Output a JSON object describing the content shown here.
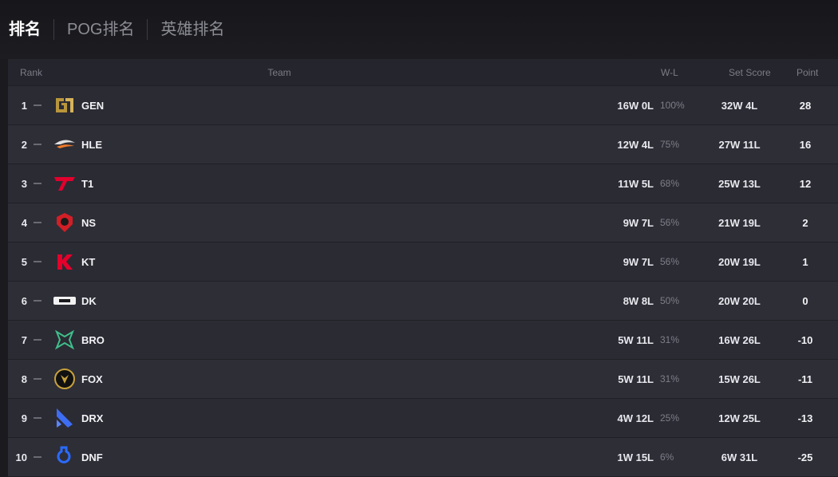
{
  "tabs": [
    {
      "label": "排名",
      "active": true
    },
    {
      "label": "POG排名",
      "active": false
    },
    {
      "label": "英雄排名",
      "active": false
    }
  ],
  "headers": {
    "rank": "Rank",
    "team": "Team",
    "wl": "W-L",
    "set": "Set Score",
    "point": "Point"
  },
  "rows": [
    {
      "rank": "1",
      "team": "GEN",
      "wl": "16W 0L",
      "pct": "100%",
      "set": "32W 4L",
      "point": "28",
      "logo": "gen-logo-icon"
    },
    {
      "rank": "2",
      "team": "HLE",
      "wl": "12W 4L",
      "pct": "75%",
      "set": "27W 11L",
      "point": "16",
      "logo": "hle-logo-icon"
    },
    {
      "rank": "3",
      "team": "T1",
      "wl": "11W 5L",
      "pct": "68%",
      "set": "25W 13L",
      "point": "12",
      "logo": "t1-logo-icon"
    },
    {
      "rank": "4",
      "team": "NS",
      "wl": "9W 7L",
      "pct": "56%",
      "set": "21W 19L",
      "point": "2",
      "logo": "ns-logo-icon"
    },
    {
      "rank": "5",
      "team": "KT",
      "wl": "9W 7L",
      "pct": "56%",
      "set": "20W 19L",
      "point": "1",
      "logo": "kt-logo-icon"
    },
    {
      "rank": "6",
      "team": "DK",
      "wl": "8W 8L",
      "pct": "50%",
      "set": "20W 20L",
      "point": "0",
      "logo": "dk-logo-icon"
    },
    {
      "rank": "7",
      "team": "BRO",
      "wl": "5W 11L",
      "pct": "31%",
      "set": "16W 26L",
      "point": "-10",
      "logo": "bro-logo-icon"
    },
    {
      "rank": "8",
      "team": "FOX",
      "wl": "5W 11L",
      "pct": "31%",
      "set": "15W 26L",
      "point": "-11",
      "logo": "fox-logo-icon"
    },
    {
      "rank": "9",
      "team": "DRX",
      "wl": "4W 12L",
      "pct": "25%",
      "set": "12W 25L",
      "point": "-13",
      "logo": "drx-logo-icon"
    },
    {
      "rank": "10",
      "team": "DNF",
      "wl": "1W 15L",
      "pct": "6%",
      "set": "6W 31L",
      "point": "-25",
      "logo": "dnf-logo-icon"
    }
  ]
}
